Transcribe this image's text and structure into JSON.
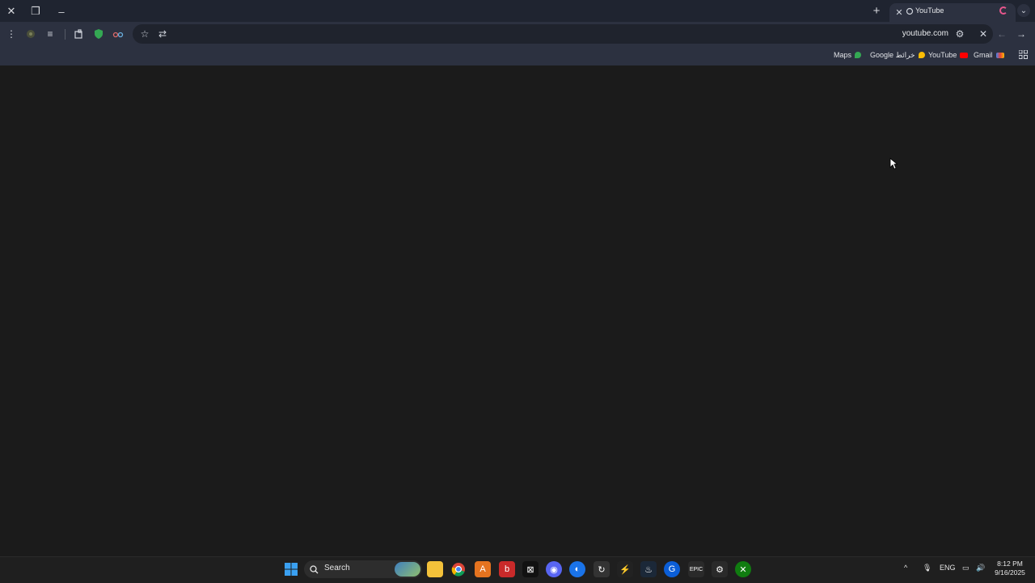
{
  "window": {
    "close_glyph": "✕",
    "restore_glyph": "❐",
    "minimize_glyph": "–"
  },
  "tab": {
    "title": "YouTube",
    "close_glyph": "✕",
    "new_tab_glyph": "+",
    "tab_list_glyph": "⌄"
  },
  "toolbar": {
    "url": "youtube.com",
    "icons": [
      "menu-icon",
      "extension-avatar-icon",
      "reading-list-icon",
      "extensions-icon",
      "shield-icon",
      "incognito-glasses-icon",
      "bookmark-star-icon",
      "share-icon",
      "site-settings-icon",
      "stop-icon",
      "back-icon",
      "forward-icon"
    ]
  },
  "bookmarks": [
    {
      "label": "Maps"
    },
    {
      "label": "Google خرائط"
    },
    {
      "label": "YouTube"
    },
    {
      "label": "Gmail"
    }
  ],
  "taskbar": {
    "search_label": "Search",
    "language": "ENG",
    "time": "8:12 PM",
    "date": "9/16/2025"
  },
  "colors": {
    "accent_pink": "#e8578d",
    "page_bg": "#1b1b1b",
    "chrome_bg": "#2c3140"
  }
}
